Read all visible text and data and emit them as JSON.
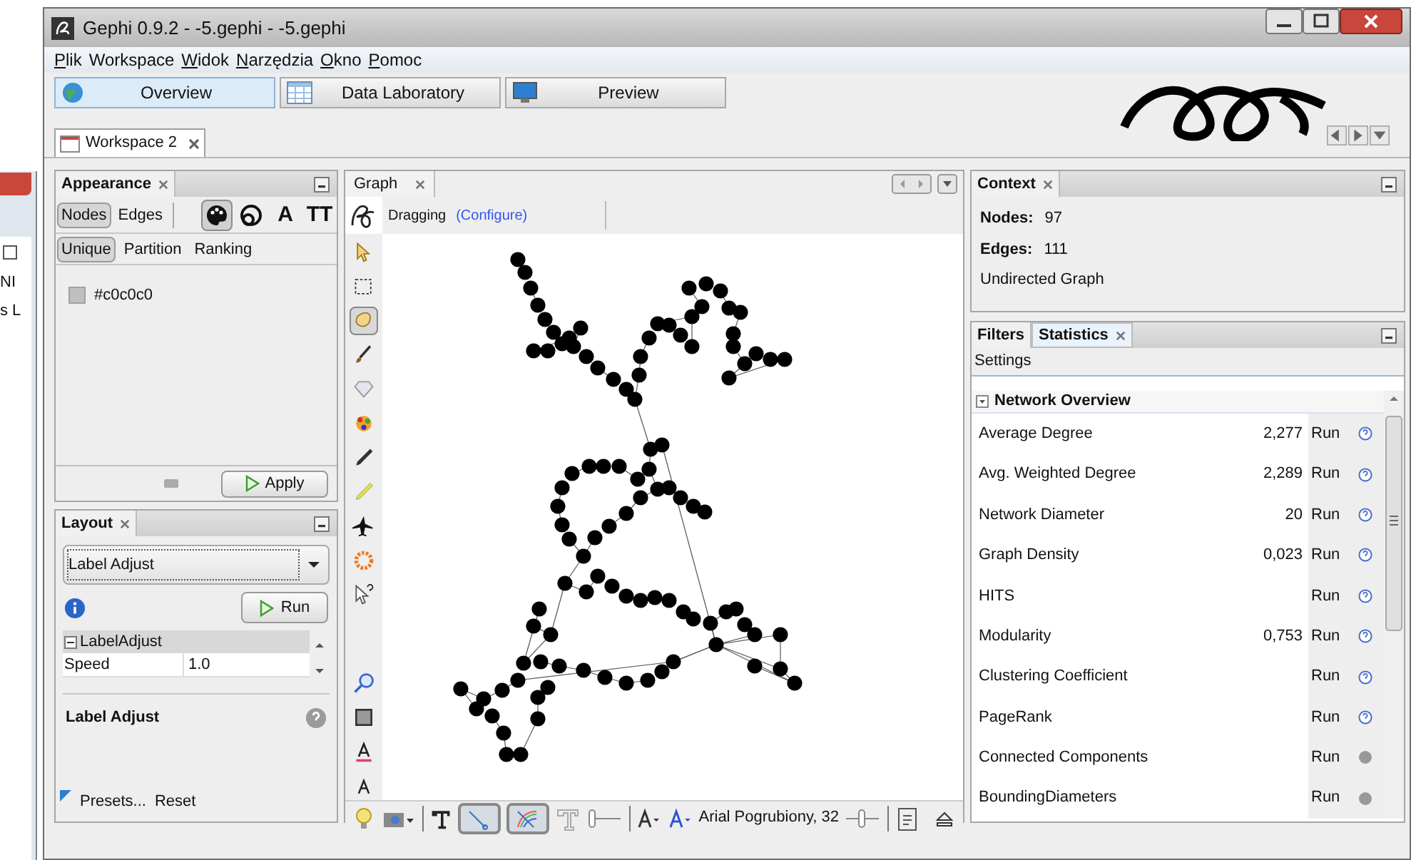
{
  "background_window": {
    "checkbox_checked": false,
    "texts": [
      "NI",
      "s L"
    ]
  },
  "window": {
    "title": "Gephi 0.9.2 - -5.gephi - -5.gephi"
  },
  "menu": [
    {
      "label": "Plik",
      "underlined": true
    },
    {
      "label": "Workspace",
      "underlined": false
    },
    {
      "label": "Widok",
      "underlined": true
    },
    {
      "label": "Narzędzia",
      "underlined": true
    },
    {
      "label": "Okno",
      "underlined": true
    },
    {
      "label": "Pomoc",
      "underlined": true
    }
  ],
  "perspectives": [
    {
      "label": "Overview",
      "selected": true
    },
    {
      "label": "Data Laboratory",
      "selected": false
    },
    {
      "label": "Preview",
      "selected": false
    }
  ],
  "workspace_tabs": [
    {
      "label": "Workspace 2",
      "selected": true
    }
  ],
  "appearance": {
    "title": "Appearance",
    "target_tabs": [
      {
        "label": "Nodes",
        "selected": true
      },
      {
        "label": "Edges",
        "selected": false
      }
    ],
    "attribute_tabs": [
      {
        "kind": "palette",
        "selected": true
      },
      {
        "kind": "size",
        "selected": false
      },
      {
        "kind": "glyph",
        "text": "A",
        "selected": false
      },
      {
        "kind": "glyph",
        "text": "TT",
        "selected": false
      }
    ],
    "mode_tabs": [
      {
        "label": "Unique",
        "selected": true
      },
      {
        "label": "Partition",
        "selected": false
      },
      {
        "label": "Ranking",
        "selected": false
      }
    ],
    "color_value": "#c0c0c0",
    "apply_button": "Apply"
  },
  "layout": {
    "title": "Layout",
    "algorithm": "Label Adjust",
    "run_button": "Run",
    "properties": {
      "group": "LabelAdjust",
      "expanded": true,
      "rows": [
        {
          "name": "Speed",
          "value": "1.0"
        }
      ]
    },
    "description_title": "Label Adjust",
    "presets": "Presets...",
    "reset": "Reset"
  },
  "graph": {
    "tab": "Graph",
    "tool": "Dragging",
    "configure": "(Configure)",
    "tools": [
      {
        "selected": false
      },
      {
        "selected": false
      },
      {
        "selected": true
      },
      {
        "selected": false
      },
      {
        "selected": false
      },
      {
        "selected": false
      },
      {
        "selected": false
      },
      {
        "selected": false
      },
      {
        "selected": false
      },
      {
        "selected": false
      },
      {
        "selected": false
      },
      {
        "selected": false
      },
      {
        "selected": false
      },
      {
        "selected": false
      },
      {
        "selected": false
      }
    ],
    "show_edges": true,
    "edge_color_from_nodes": true,
    "font_label": "Arial Pogrubiony, 32"
  },
  "context": {
    "title": "Context",
    "stats": [
      {
        "label": "Nodes:",
        "value": "97"
      },
      {
        "label": "Edges:",
        "value": "111"
      }
    ],
    "graph_type": "Undirected Graph"
  },
  "statistics": {
    "tabs": [
      {
        "label": "Filters",
        "selected": false
      },
      {
        "label": "Statistics",
        "selected": true
      }
    ],
    "settings": "Settings",
    "section": {
      "title": "Network Overview",
      "expanded": true
    },
    "rows": [
      {
        "name": "Average Degree",
        "value": "2,277",
        "run": "Run",
        "help_available": true
      },
      {
        "name": "Avg. Weighted Degree",
        "value": "2,289",
        "run": "Run",
        "help_available": true
      },
      {
        "name": "Network Diameter",
        "value": "20",
        "run": "Run",
        "help_available": true
      },
      {
        "name": "Graph Density",
        "value": "0,023",
        "run": "Run",
        "help_available": true
      },
      {
        "name": "HITS",
        "run": "Run",
        "help_available": true
      },
      {
        "name": "Modularity",
        "value": "0,753",
        "run": "Run",
        "help_available": true
      },
      {
        "name": "Clustering Coefficient",
        "run": "Run",
        "help_available": true
      },
      {
        "name": "PageRank",
        "run": "Run",
        "help_available": true
      },
      {
        "name": "Connected Components",
        "run": "Run",
        "help_available": false
      },
      {
        "name": "BoundingDiameters",
        "run": "Run",
        "help_available": false
      }
    ]
  }
}
